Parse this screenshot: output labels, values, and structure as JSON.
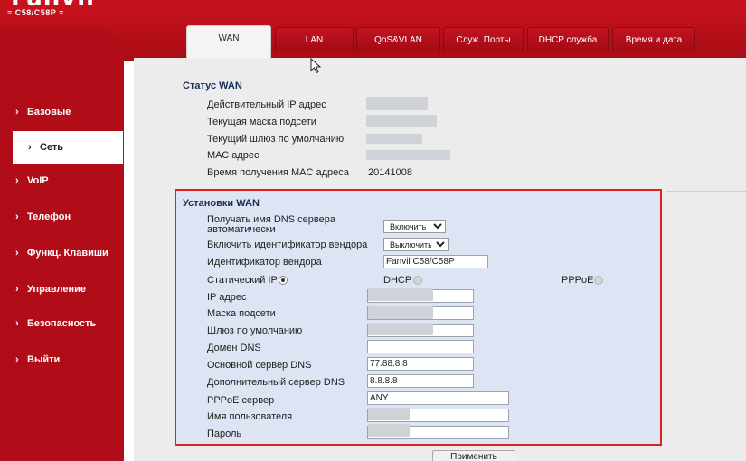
{
  "logo": {
    "word": "Fanvil",
    "model": "≡ C58/C58P ≡"
  },
  "sidebar": {
    "items": [
      {
        "label": "Базовые",
        "active": false
      },
      {
        "label": "Сеть",
        "active": true
      },
      {
        "label": "VoIP",
        "active": false
      },
      {
        "label": "Телефон",
        "active": false
      },
      {
        "label": "Функц. Клавиши",
        "active": false
      },
      {
        "label": "Управление",
        "active": false
      },
      {
        "label": "Безопасность",
        "active": false
      },
      {
        "label": "Выйти",
        "active": false
      }
    ]
  },
  "tabs": [
    {
      "label": "WAN",
      "active": true
    },
    {
      "label": "LAN",
      "active": false
    },
    {
      "label": "QoS&VLAN",
      "active": false
    },
    {
      "label": "Служ. Порты",
      "active": false
    },
    {
      "label": "DHCP служба",
      "active": false
    },
    {
      "label": "Время и дата",
      "active": false
    }
  ],
  "status": {
    "title": "Статус WAN",
    "rows": [
      {
        "label": "Действительный IP адрес",
        "value": ""
      },
      {
        "label": "Текущая маска подсети",
        "value": ""
      },
      {
        "label": "Текущий шлюз по умолчанию",
        "value": ""
      },
      {
        "label": "МАС адрес",
        "value": ""
      },
      {
        "label": "Время получения MAC адреса",
        "value": "20141008"
      }
    ]
  },
  "wan": {
    "title": "Установки WAN",
    "dns_auto_label": "Получать имя DNS сервера автоматически",
    "dns_auto_value": "Включить",
    "vendor_id_enable_label": "Включить идентификатор вендора",
    "vendor_id_enable_value": "Выключить",
    "vendor_id_label": "Идентификатор вендора",
    "vendor_id_value": "Fanvil C58/C58P",
    "mode": {
      "static_label": "Статический IP",
      "dhcp_label": "DHCP",
      "pppoe_label": "PPPoE",
      "selected": "static"
    },
    "ip_label": "IP адрес",
    "mask_label": "Маска подсети",
    "gateway_label": "Шлюз по умолчанию",
    "domain_label": "Домен DNS",
    "domain_value": "",
    "primary_dns_label": "Основной сервер DNS",
    "primary_dns_value": "77.88.8.8",
    "secondary_dns_label": "Дополнительный сервер DNS",
    "secondary_dns_value": "8.8.8.8",
    "pppoe_server_label": "PPPoE сервер",
    "pppoe_server_value": "ANY",
    "username_label": "Имя пользователя",
    "password_label": "Пароль"
  },
  "apply_label": "Применить",
  "colors": {
    "brand_red": "#b00d18",
    "highlight_border": "#e02020",
    "settings_bg": "#dde4f4"
  },
  "icons": {
    "cursor": "arrow-cursor-icon",
    "nav_chevron": "chevron-right-icon"
  }
}
